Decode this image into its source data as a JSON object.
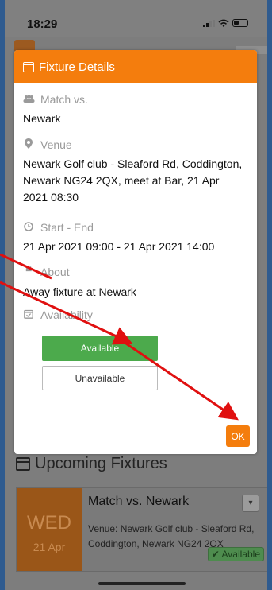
{
  "status_bar": {
    "time": "18:29"
  },
  "modal": {
    "title": "Fixture Details",
    "match": {
      "label": "Match vs.",
      "value": "Newark"
    },
    "venue": {
      "label": "Venue",
      "value": "Newark Golf club - Sleaford Rd, Coddington, Newark NG24 2QX, meet at Bar, 21 Apr 2021 08:30"
    },
    "time": {
      "label": "Start - End",
      "value": "21 Apr 2021 09:00 - 21 Apr 2021 14:00"
    },
    "about": {
      "label": "About",
      "value": "Away fixture at Newark"
    },
    "availability": {
      "label": "Availability"
    },
    "available_button": "Available",
    "unavailable_button": "Unavailable",
    "ok_button": "OK"
  },
  "background": {
    "section_title": "Upcoming Fixtures",
    "card": {
      "day": "WED",
      "date": "21 Apr",
      "title": "Match vs. Newark",
      "venue": "Venue: Newark Golf club - Sleaford Rd, Coddington, Newark NG24 2QX",
      "status": "✔ Available"
    }
  },
  "colors": {
    "accent": "#f47d0d",
    "available": "#4caa4c",
    "annotation_arrow": "#e01010"
  }
}
